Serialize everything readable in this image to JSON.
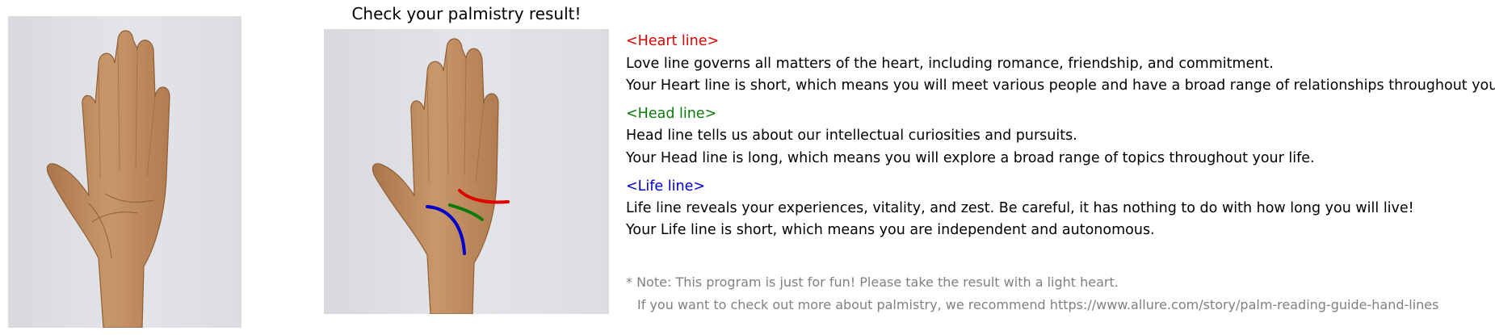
{
  "title": "Check your palmistry result!",
  "colors": {
    "heart": "#e00000",
    "head": "#0a7a0a",
    "life": "#0000cc",
    "text": "#000000",
    "note": "#808080"
  },
  "lines": {
    "heart": {
      "label": "<Heart line>",
      "description": "Love line governs all matters of the heart, including romance, friendship, and commitment.",
      "result": "Your Heart line is short, which means you will meet various people and have a broad range of relationships throughout your life."
    },
    "head": {
      "label": "<Head line>",
      "description": "Head line tells us about our intellectual curiosities and pursuits.",
      "result": "Your Head line is long, which means you will explore a broad range of topics throughout your life."
    },
    "life": {
      "label": "<Life line>",
      "description": "Life line reveals your experiences, vitality, and zest. Be careful, it has nothing to do with how long you will live!",
      "result": "Your Life line is short, which means you are independent and autonomous."
    }
  },
  "note": {
    "line1": "* Note: This program is just for fun! Please take the result with a light heart.",
    "line2": "If you want to check out more about palmistry, we recommend https://www.allure.com/story/palm-reading-guide-hand-lines"
  }
}
